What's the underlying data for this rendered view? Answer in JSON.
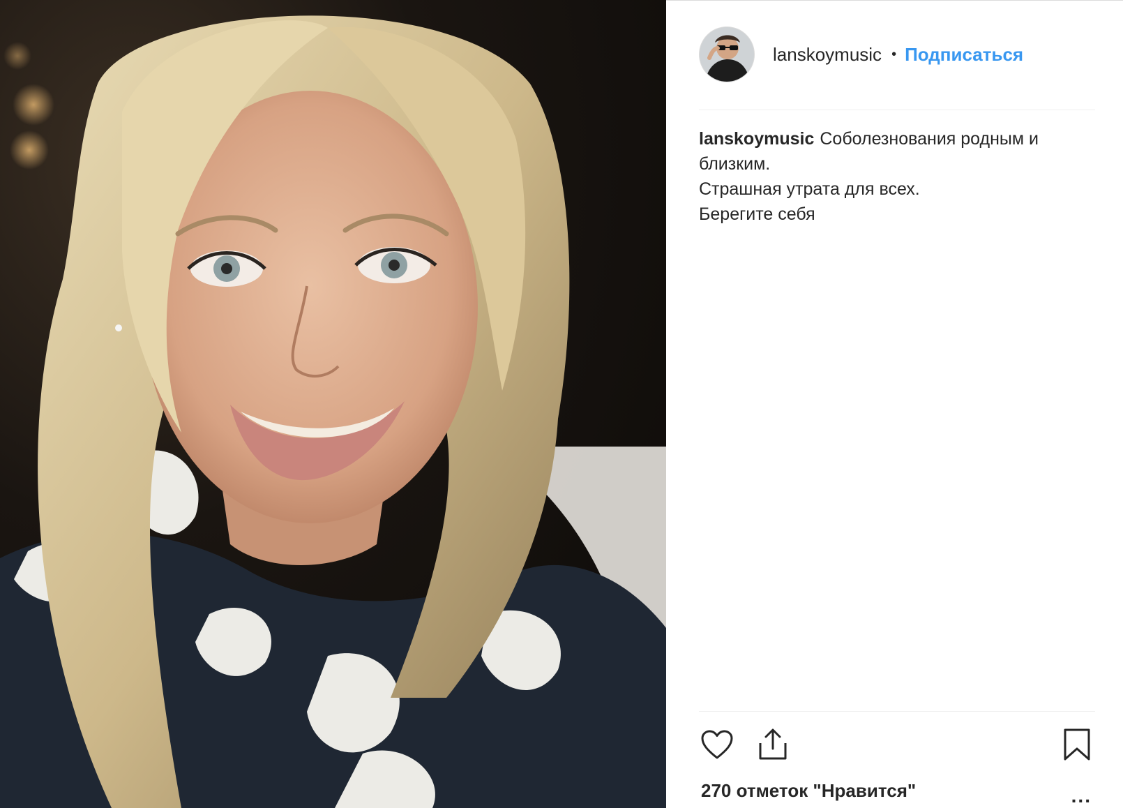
{
  "post": {
    "author": {
      "username": "lanskoymusic",
      "separator": "•",
      "follow_label": "Подписаться"
    },
    "caption": {
      "username": "lanskoymusic",
      "lines": [
        "Соболезнования родным и близким.",
        "Страшная утрата для всех.",
        "Берегите себя"
      ]
    },
    "likes_text": "270 отметок \"Нравится\"",
    "more_label": "...",
    "icons": {
      "like": "heart-icon",
      "share": "share-icon",
      "save": "bookmark-icon"
    },
    "colors": {
      "accent": "#3897f0",
      "text": "#262626",
      "divider": "#efefef"
    }
  }
}
